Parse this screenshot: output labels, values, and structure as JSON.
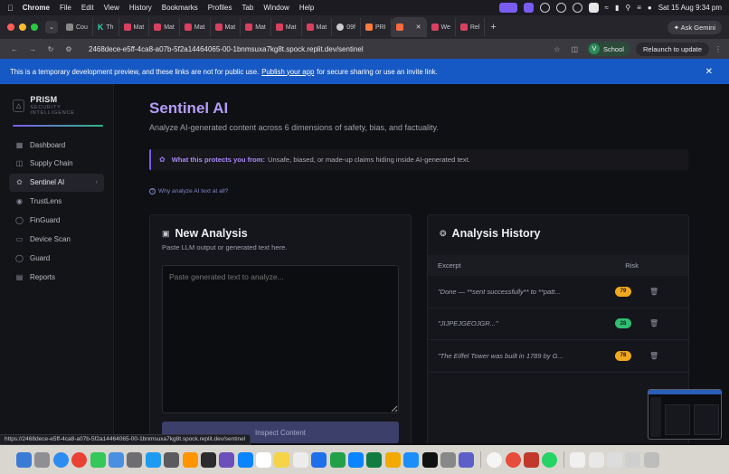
{
  "menubar": {
    "app": "Chrome",
    "items": [
      "File",
      "Edit",
      "View",
      "History",
      "Bookmarks",
      "Profiles",
      "Tab",
      "Window",
      "Help"
    ],
    "clock": "Sat 15 Aug  9:34 pm"
  },
  "tabs": [
    {
      "label": "Cou",
      "fav": "tab-favicon"
    },
    {
      "label": "Th",
      "fav": "k"
    },
    {
      "label": "Mat",
      "fav": "tab-favicon"
    },
    {
      "label": "Mat",
      "fav": "tab-favicon"
    },
    {
      "label": "Mat",
      "fav": "tab-favicon"
    },
    {
      "label": "Mat",
      "fav": "tab-favicon"
    },
    {
      "label": "Mat",
      "fav": "tab-favicon"
    },
    {
      "label": "Mat",
      "fav": "tab-favicon"
    },
    {
      "label": "Mat",
      "fav": "tab-favicon"
    },
    {
      "label": "09f",
      "fav": "tab-favicon"
    },
    {
      "label": "PRI",
      "fav": "tab-favicon"
    },
    {
      "label": "",
      "fav": "o",
      "active": true
    },
    {
      "label": "We",
      "fav": "tab-favicon"
    },
    {
      "label": "Rel",
      "fav": "tab-favicon"
    }
  ],
  "ask_gemini": "Ask Gemini",
  "url": "2468dece-e5ff-4ca8-a07b-5f2a14464065-00-1bnmsuxa7kg8t.spock.replit.dev/sentinel",
  "profile": {
    "initial": "V",
    "name": "School"
  },
  "relaunch": "Relaunch to update",
  "banner": {
    "text_before": "This is a temporary development preview, and these links are not for public use.",
    "link": "Publish your app",
    "text_after": "for secure sharing or use an invite link."
  },
  "sidebar": {
    "brand": "PRISM",
    "brand_sub": "SECURITY INTELLIGENCE",
    "items": [
      {
        "label": "Dashboard",
        "icon": "grid-icon"
      },
      {
        "label": "Supply Chain",
        "icon": "cube-icon"
      },
      {
        "label": "Sentinel AI",
        "icon": "brain-icon",
        "active": true
      },
      {
        "label": "TrustLens",
        "icon": "lens-icon"
      },
      {
        "label": "FinGuard",
        "icon": "shield-icon"
      },
      {
        "label": "Device Scan",
        "icon": "device-icon"
      },
      {
        "label": "Guard",
        "icon": "guard-icon"
      },
      {
        "label": "Reports",
        "icon": "report-icon"
      }
    ]
  },
  "page": {
    "title": "Sentinel AI",
    "subtitle": "Analyze AI-generated content across 6 dimensions of safety, bias, and factuality.",
    "protect_label": "What this protects you from:",
    "protect_text": "Unsafe, biased, or made-up claims hiding inside AI-generated text.",
    "why_link": "Why analyze AI text at all?"
  },
  "new_analysis": {
    "title": "New Analysis",
    "desc": "Paste LLM output or generated text here.",
    "placeholder": "Paste generated text to analyze...",
    "button": "Inspect Content"
  },
  "history": {
    "title": "Analysis History",
    "col_excerpt": "Excerpt",
    "col_risk": "Risk",
    "rows": [
      {
        "excerpt": "\"Done — **sent successfully** to **patt...",
        "risk": "79",
        "color": "#f0a81d"
      },
      {
        "excerpt": "\"JIJPEJGEOJGR...\"",
        "risk": "28",
        "color": "#2fbf71"
      },
      {
        "excerpt": "\"The Eiffel Tower was built in 1789 by G...",
        "risk": "78",
        "color": "#f0a81d"
      }
    ]
  },
  "status_url": "https://2468dece-e5ff-4ca8-a07b-5f2a14464065-00-1bnmsuxa7kg8t.spock.replit.dev/sentinel",
  "colors": {
    "accent": "#7a5cf0",
    "title": "#b59cf8",
    "banner": "#1759c4"
  }
}
